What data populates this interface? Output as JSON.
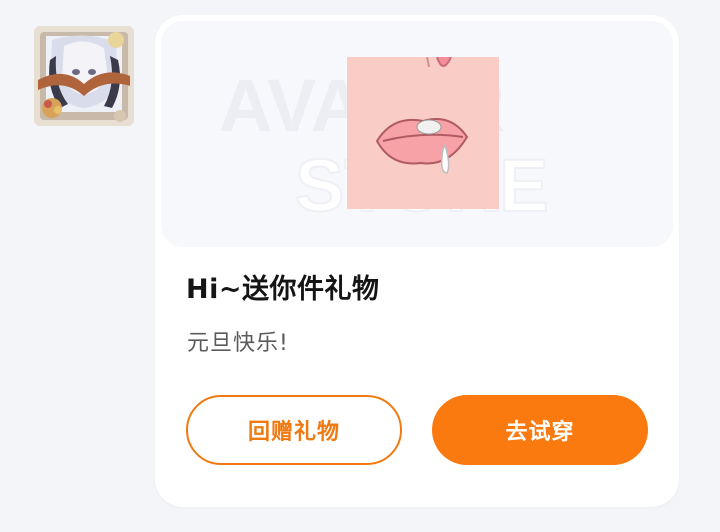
{
  "message": {
    "title": "Hi~送你件礼物",
    "subtitle": "元旦快乐!"
  },
  "banner": {
    "watermark_line1": "AVATAR",
    "watermark_line2": "STORE"
  },
  "actions": {
    "return_gift_label": "回赠礼物",
    "try_on_label": "去试穿"
  },
  "colors": {
    "accent": "#fb7a10",
    "card_bg": "#ffffff",
    "page_bg": "#f3f5f8",
    "banner_bg": "#f7f8fb",
    "sticker_bg": "#f9cdc6",
    "lip": "#f7a2a6"
  },
  "icons": {
    "avatar": "anime-avatar-icon",
    "sticker": "lips-sticker-icon"
  }
}
